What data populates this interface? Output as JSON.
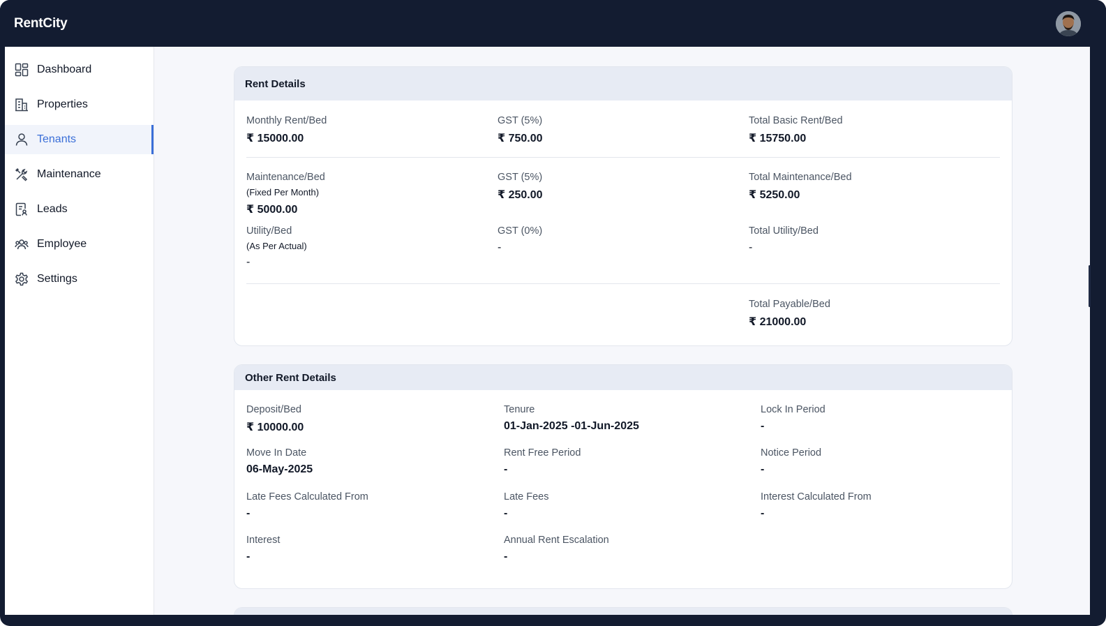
{
  "app": {
    "brand": "RentCity"
  },
  "sidebar": {
    "items": [
      {
        "label": "Dashboard",
        "icon": "dashboard-icon",
        "active": false
      },
      {
        "label": "Properties",
        "icon": "building-icon",
        "active": false
      },
      {
        "label": "Tenants",
        "icon": "user-icon",
        "active": true
      },
      {
        "label": "Maintenance",
        "icon": "tools-icon",
        "active": false
      },
      {
        "label": "Leads",
        "icon": "document-user-icon",
        "active": false
      },
      {
        "label": "Employee",
        "icon": "users-icon",
        "active": false
      },
      {
        "label": "Settings",
        "icon": "gear-icon",
        "active": false
      }
    ]
  },
  "rent_details": {
    "title": "Rent Details",
    "monthly_rent": {
      "label": "Monthly Rent/Bed",
      "value": "₹ 15000.00"
    },
    "monthly_rent_gst": {
      "label": "GST (5%)",
      "value": "₹ 750.00"
    },
    "total_basic_rent": {
      "label": "Total Basic Rent/Bed",
      "value": "₹ 15750.00"
    },
    "maintenance": {
      "label": "Maintenance/Bed",
      "sub": "(Fixed Per Month)",
      "value": "₹ 5000.00"
    },
    "maintenance_gst": {
      "label": "GST (5%)",
      "value": "₹ 250.00"
    },
    "total_maintenance": {
      "label": "Total Maintenance/Bed",
      "value": "₹ 5250.00"
    },
    "utility": {
      "label": "Utility/Bed",
      "sub": "(As Per Actual)",
      "value": "-"
    },
    "utility_gst": {
      "label": "GST (0%)",
      "value": "-"
    },
    "total_utility": {
      "label": "Total Utility/Bed",
      "value": "-"
    },
    "total_payable": {
      "label": "Total Payable/Bed",
      "value": "₹ 21000.00"
    }
  },
  "other_rent_details": {
    "title": "Other Rent Details",
    "deposit": {
      "label": "Deposit/Bed",
      "value": "₹ 10000.00"
    },
    "tenure": {
      "label": "Tenure",
      "value": "01-Jan-2025 -01-Jun-2025"
    },
    "lock_in": {
      "label": "Lock In Period",
      "value": "-"
    },
    "move_in": {
      "label": "Move In Date",
      "value": "06-May-2025"
    },
    "rent_free": {
      "label": "Rent Free Period",
      "value": "-"
    },
    "notice": {
      "label": "Notice Period",
      "value": "-"
    },
    "late_fees_from": {
      "label": "Late Fees Calculated From",
      "value": "-"
    },
    "late_fees": {
      "label": "Late Fees",
      "value": "-"
    },
    "interest_from": {
      "label": "Interest Calculated From",
      "value": "-"
    },
    "interest": {
      "label": "Interest",
      "value": "-"
    },
    "escalation": {
      "label": "Annual Rent Escalation",
      "value": "-"
    }
  },
  "colors": {
    "topbar": "#131c31",
    "accent": "#3b6fd8",
    "card_header": "#e7ebf4",
    "page_bg": "#f6f7fb"
  }
}
